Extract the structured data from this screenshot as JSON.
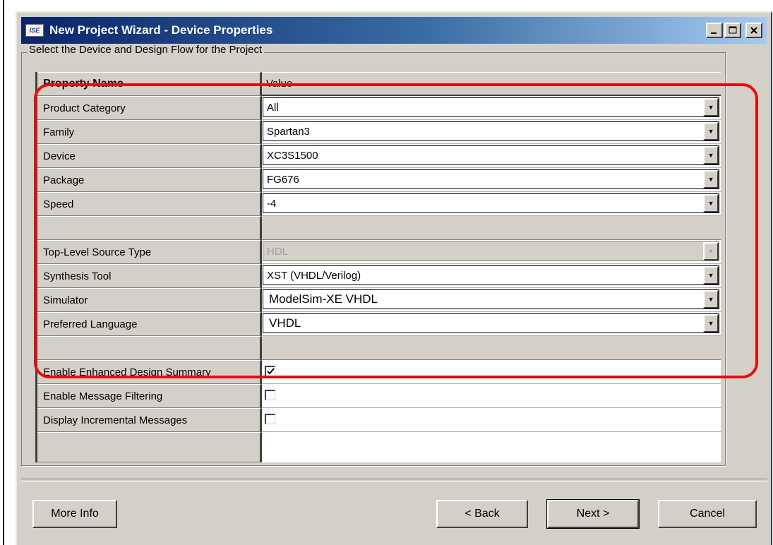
{
  "window": {
    "title": "New Project Wizard - Device Properties",
    "app_icon_label": "ISE",
    "controls": [
      "minimize",
      "maximize",
      "close"
    ]
  },
  "group": {
    "label": "Select the Device and Design Flow for the Project"
  },
  "grid": {
    "header": {
      "name": "Property Name",
      "value": "Value"
    },
    "rows": [
      {
        "name": "Product Category",
        "value": "All"
      },
      {
        "name": "Family",
        "value": "Spartan3"
      },
      {
        "name": "Device",
        "value": "XC3S1500"
      },
      {
        "name": "Package",
        "value": "FG676"
      },
      {
        "name": "Speed",
        "value": "-4"
      },
      {
        "name": "",
        "value": ""
      },
      {
        "name": "Top-Level Source Type",
        "value": "HDL"
      },
      {
        "name": "Synthesis Tool",
        "value": "XST (VHDL/Verilog)"
      },
      {
        "name": "Simulator",
        "value": "ModelSim-XE VHDL"
      },
      {
        "name": "Preferred Language",
        "value": "VHDL"
      },
      {
        "name": "",
        "value": ""
      },
      {
        "name": "Enable Enhanced Design Summary",
        "checked": true
      },
      {
        "name": "Enable Message Filtering",
        "checked": false
      },
      {
        "name": "Display Incremental Messages",
        "checked": false
      }
    ]
  },
  "colors": {
    "highlight": "#e01010",
    "title_start": "#0a246a",
    "title_end": "#a6caf0",
    "dialog_bg": "#d4d0c8"
  },
  "buttons": {
    "more_info": "More Info",
    "back": "< Back",
    "next": "Next >",
    "cancel": "Cancel"
  }
}
